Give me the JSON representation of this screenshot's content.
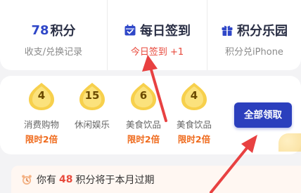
{
  "header": {
    "points_stat": {
      "number": "78",
      "unit": "积分",
      "sub": "收支/兑换记录"
    },
    "checkin_stat": {
      "title": "每日签到",
      "sub": "今日签到 +1"
    },
    "mall_stat": {
      "title": "积分乐园",
      "sub": "积分兑iPhone"
    }
  },
  "tasks": [
    {
      "points": "4",
      "label": "消费购物",
      "badge": "限时2倍"
    },
    {
      "points": "15",
      "label": "休闲娱乐",
      "badge": ""
    },
    {
      "points": "6",
      "label": "美食饮品",
      "badge": "限时2倍"
    },
    {
      "points": "4",
      "label": "美食饮品",
      "badge": "限时2倍"
    }
  ],
  "claim_all_label": "全部领取",
  "notice": {
    "prefix": "你有",
    "amount": "48",
    "suffix": "积分将于本月过期"
  },
  "colors": {
    "accent_blue": "#2b3fbd",
    "highlight_red": "#e8483b",
    "badge_orange": "#ef6a1c",
    "coin_gold": "#f7d04c"
  },
  "icons": [
    "calendar-check-icon",
    "gift-icon",
    "alarm-clock-icon",
    "coin-icon",
    "arrow-annotation"
  ]
}
